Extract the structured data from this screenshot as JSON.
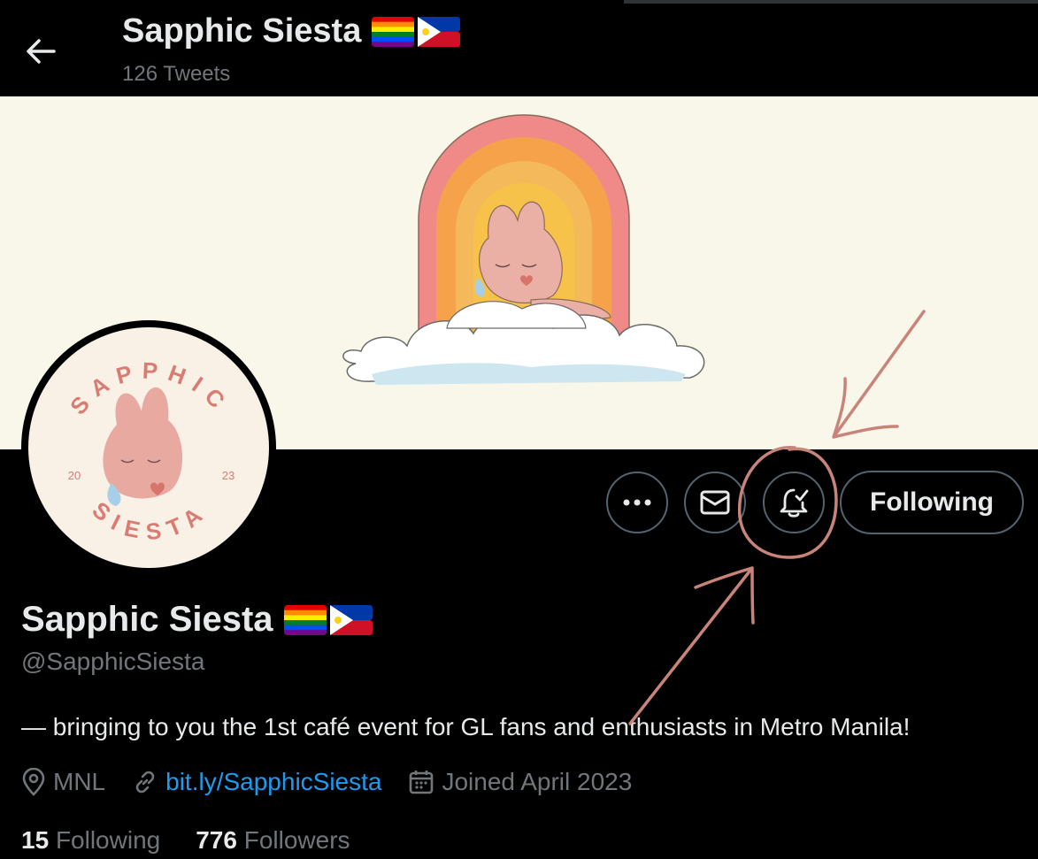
{
  "header": {
    "name": "Sapphic Siesta",
    "tweet_count": "126 Tweets",
    "flags": [
      "pride-flag",
      "philippines-flag"
    ]
  },
  "profile": {
    "name": "Sapphic Siesta",
    "handle": "@SapphicSiesta",
    "bio": "— bringing to you the 1st café event for GL fans and enthusiasts in Metro Manila!",
    "location": "MNL",
    "link": "bit.ly/SapphicSiesta",
    "joined": "Joined April 2023",
    "following_count": "15",
    "following_label": "Following",
    "followers_count": "776",
    "followers_label": "Followers"
  },
  "avatar_logo": {
    "top_text": "SAPPHIC",
    "bottom_text": "SIESTA",
    "year_left": "20",
    "year_right": "23"
  },
  "actions": {
    "follow_label": "Following",
    "icons": [
      "more-icon",
      "envelope-icon",
      "bell-check-icon"
    ]
  },
  "colors": {
    "background": "#000000",
    "link": "#1d9bf0",
    "muted": "#71767b",
    "annotation": "#c9847a",
    "banner": "#f9f6ea"
  }
}
